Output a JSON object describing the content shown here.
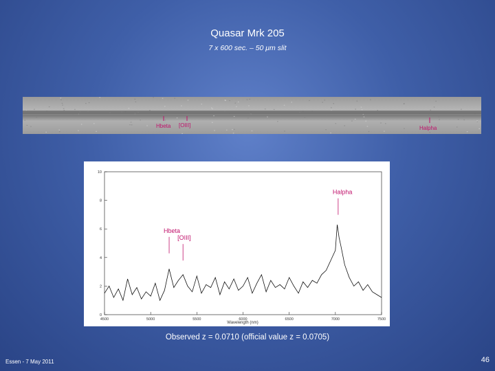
{
  "slide": {
    "title": "Quasar Mrk 205",
    "subtitle": "7 x 600 sec. – 50 μm slit",
    "caption": "Observed z = 0.0710 (official value z = 0.0705)",
    "footer": "Essen - 7 May 2011",
    "page_number": "46"
  },
  "strip": {
    "labels": [
      "Hbeta",
      "[OIII]",
      "Halpha"
    ],
    "label_color": "#c0106a"
  },
  "chart_data": {
    "type": "line",
    "title": "",
    "xlabel": "Wavelength (nm)",
    "ylabel": "",
    "xlim": [
      4500,
      7500
    ],
    "ylim": [
      0,
      10
    ],
    "x_ticks": [
      "4500",
      "5000",
      "5500",
      "6000",
      "6500",
      "7000",
      "7500"
    ],
    "y_ticks": [
      "0",
      "2",
      "4",
      "6",
      "8",
      "10"
    ],
    "annotations": [
      {
        "label": "Hbeta",
        "x": 5200,
        "y": 4.0
      },
      {
        "label": "[OIII]",
        "x": 5350,
        "y": 3.5
      },
      {
        "label": "Halpha",
        "x": 7030,
        "y": 6.7
      }
    ],
    "annotation_color": "#c0106a",
    "series": [
      {
        "x": [
          4500,
          4550,
          4600,
          4650,
          4700,
          4750,
          4800,
          4850,
          4900,
          4950,
          5000,
          5050,
          5100,
          5150,
          5200,
          5250,
          5300,
          5350,
          5400,
          5450,
          5500,
          5550,
          5600,
          5650,
          5700,
          5750,
          5800,
          5850,
          5900,
          5950,
          6000,
          6050,
          6100,
          6150,
          6200,
          6250,
          6300,
          6350,
          6400,
          6450,
          6500,
          6550,
          6600,
          6650,
          6700,
          6750,
          6800,
          6850,
          6900,
          6950,
          7000,
          7020,
          7040,
          7060,
          7100,
          7150,
          7200,
          7250,
          7300,
          7350,
          7400,
          7450,
          7500
        ],
        "y": [
          1.5,
          2.0,
          1.2,
          1.8,
          1.0,
          2.5,
          1.4,
          1.9,
          1.1,
          1.6,
          1.3,
          2.2,
          1.0,
          1.7,
          3.2,
          1.9,
          2.4,
          2.8,
          2.0,
          1.6,
          2.7,
          1.5,
          2.1,
          1.9,
          2.6,
          1.4,
          2.3,
          1.8,
          2.5,
          1.7,
          2.0,
          2.6,
          1.5,
          2.2,
          2.8,
          1.6,
          2.4,
          1.9,
          2.1,
          1.8,
          2.6,
          2.0,
          1.5,
          2.3,
          1.9,
          2.4,
          2.2,
          2.8,
          3.1,
          3.8,
          4.5,
          6.3,
          5.4,
          4.8,
          3.5,
          2.6,
          2.0,
          2.3,
          1.7,
          2.1,
          1.6,
          1.4,
          1.2
        ]
      }
    ]
  }
}
